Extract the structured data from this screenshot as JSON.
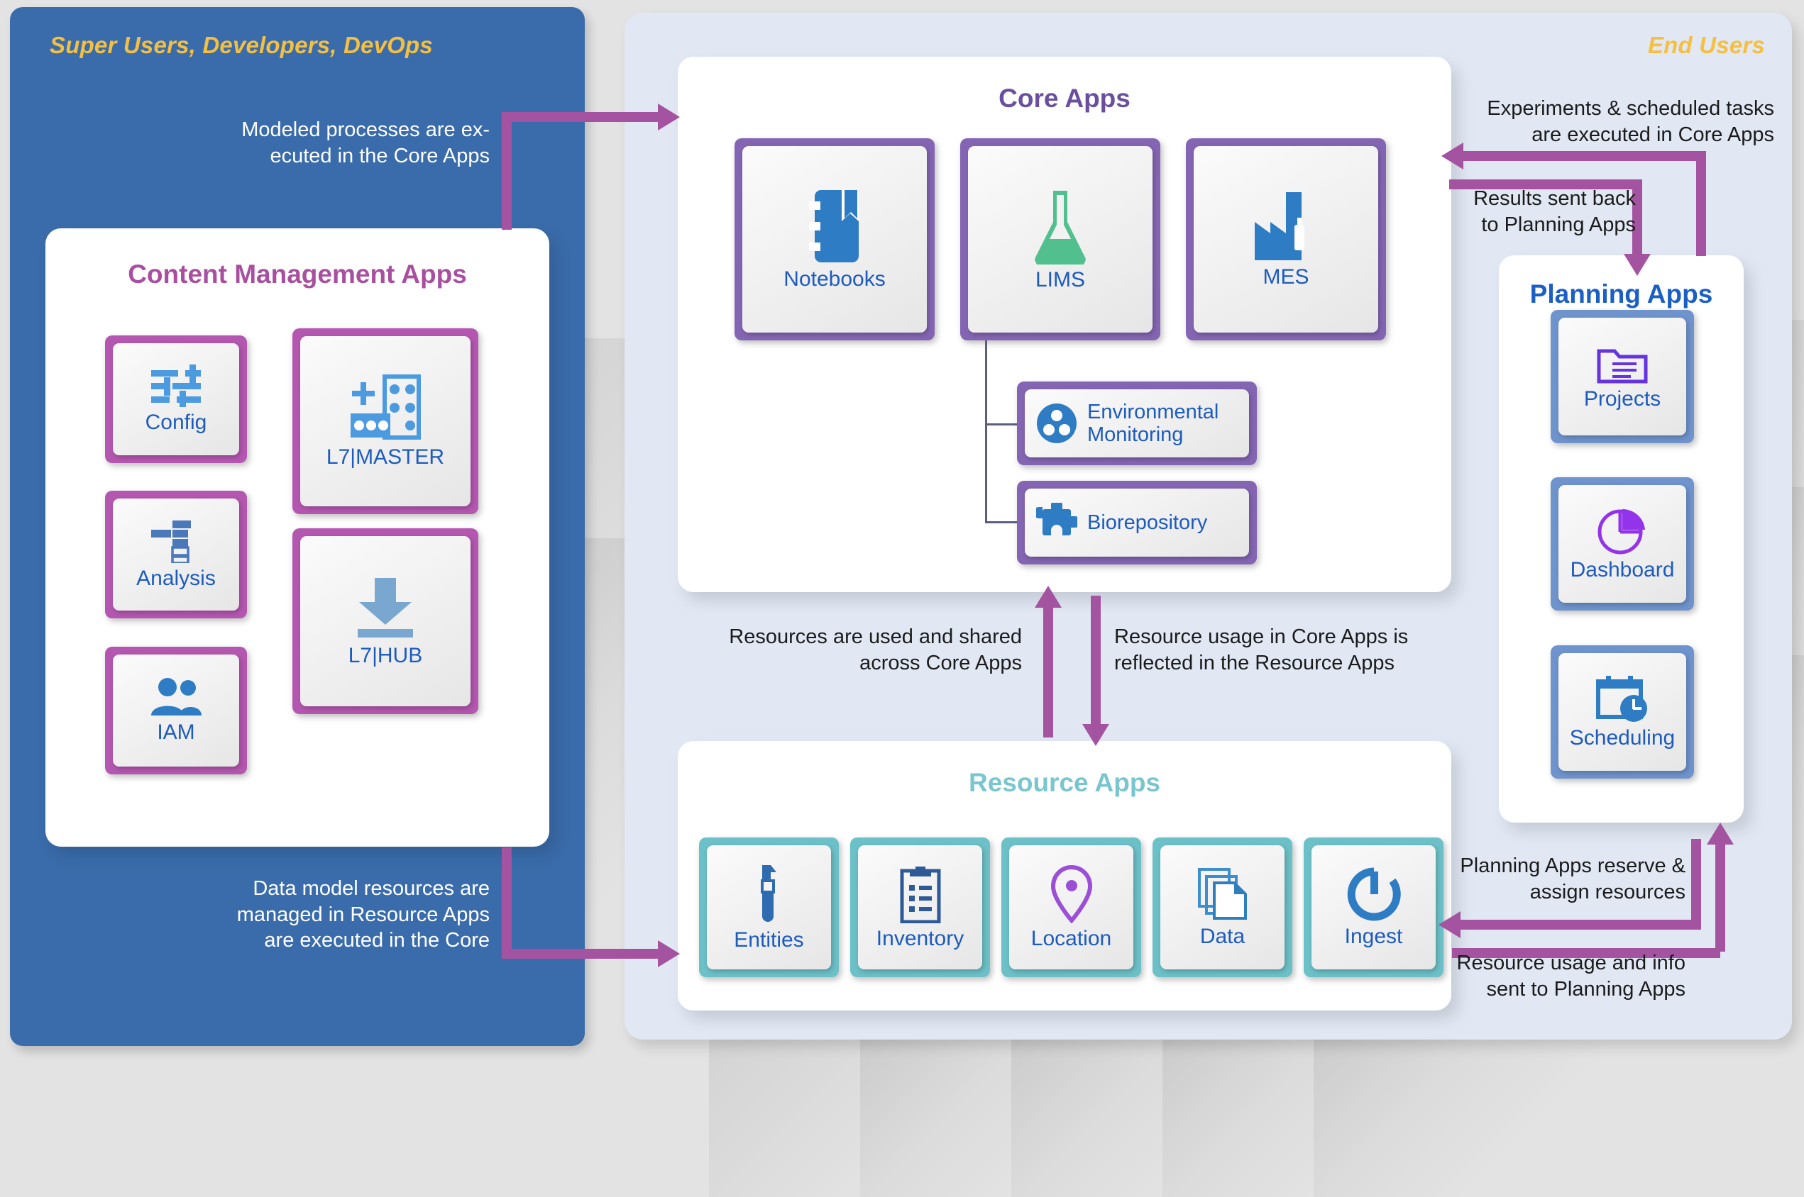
{
  "personas": {
    "left": "Super Users, Developers, DevOps",
    "right": "End Users"
  },
  "groups": {
    "content_management": {
      "title": "Content Management Apps",
      "small_apps": [
        {
          "label": "Config",
          "icon": "sliders-icon"
        },
        {
          "label": "Analysis",
          "icon": "hierarchy-chart-icon"
        },
        {
          "label": "IAM",
          "icon": "users-icon"
        }
      ],
      "big_apps": [
        {
          "label": "L7|MASTER",
          "icon": "master-data-building-icon"
        },
        {
          "label": "L7|HUB",
          "icon": "download-arrow-icon"
        }
      ]
    },
    "core": {
      "title": "Core Apps",
      "apps": [
        {
          "label": "Notebooks",
          "icon": "notebook-icon"
        },
        {
          "label": "LIMS",
          "icon": "flask-icon"
        },
        {
          "label": "MES",
          "icon": "factory-icon"
        }
      ],
      "sub_apps": [
        {
          "label": "Environmental Monitoring",
          "icon": "petri-dish-icon"
        },
        {
          "label": "Biorepository",
          "icon": "puzzle-piece-icon"
        }
      ]
    },
    "resource": {
      "title": "Resource Apps",
      "apps": [
        {
          "label": "Entities",
          "icon": "test-tube-icon"
        },
        {
          "label": "Inventory",
          "icon": "clipboard-list-icon"
        },
        {
          "label": "Location",
          "icon": "map-pin-icon"
        },
        {
          "label": "Data",
          "icon": "documents-stack-icon"
        },
        {
          "label": "Ingest",
          "icon": "circular-arrow-icon"
        }
      ]
    },
    "planning": {
      "title": "Planning Apps",
      "apps": [
        {
          "label": "Projects",
          "icon": "folder-icon"
        },
        {
          "label": "Dashboard",
          "icon": "pie-chart-icon"
        },
        {
          "label": "Scheduling",
          "icon": "calendar-clock-icon"
        }
      ]
    }
  },
  "annotations": {
    "modeled_processes": "Modeled processes are ex-\necuted in the Core Apps",
    "data_model_resources": "Data model resources are\nmanaged in Resource Apps\nare executed in the Core",
    "resources_shared": "Resources are used and shared\nacross Core Apps",
    "resource_usage_reflected": "Resource usage in Core Apps is\nreflected in the Resource Apps",
    "experiments_scheduled": "Experiments & scheduled tasks\nare executed in Core Apps",
    "results_sent_back": "Results sent back\nto Planning Apps",
    "planning_reserve": "Planning Apps reserve &\nassign resources",
    "resource_usage_sent": "Resource usage and info\nsent to Planning Apps"
  },
  "colors": {
    "left_panel": "#3a6cab",
    "right_panel": "#e1e8f4",
    "persona_yellow": "#f5bf3f",
    "arrow_purple": "#a3539f",
    "cma_title": "#a94fa0",
    "core_title": "#6a4f9e",
    "resource_title": "#79c6cf",
    "planning_title": "#1c5fc4",
    "tile_label_blue": "#1d5bbf",
    "frame_purple": "#b457b0",
    "frame_core_purple": "#8465b3",
    "frame_teal": "#6cc0c7",
    "frame_blue": "#6f93cd"
  }
}
